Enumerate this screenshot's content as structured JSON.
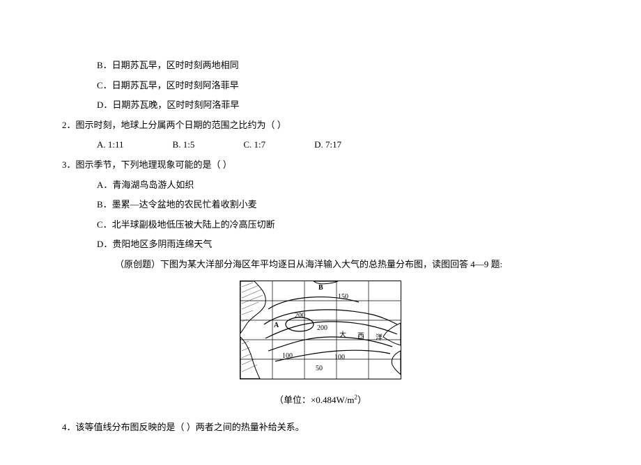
{
  "q1partial": {
    "optB": "B．日期苏瓦早，区时时刻两地相同",
    "optC": "C．日期苏瓦早，区时时刻阿洛菲早",
    "optD": "D．日期苏瓦晚，区时时刻阿洛菲早"
  },
  "q2": {
    "stem": "2．图示时刻，地球上分属两个日期的范围之比约为（    ）",
    "optA": "A. 1:11",
    "optB": "B. 1:5",
    "optC": "C. 1:7",
    "optD": "D. 7:17"
  },
  "q3": {
    "stem": "3．图示季节，下列地理现象可能的是（   ）",
    "optA": "A．青海湖鸟岛游人如织",
    "optB": "B．墨累—达令盆地的农民忙着收割小麦",
    "optC": "C．北半球副极地低压被大陆上的冷高压切断",
    "optD": "D．贵阳地区多阴雨连绵天气"
  },
  "intro": "（原创题）下图为某大洋部分海区年平均逐日从海洋输入大气的总热量分布图，读图回答 4—9 题:",
  "caption": "（单位：×0.484W/m",
  "caption_sup": "2",
  "caption_close": "）",
  "map": {
    "v150": "150",
    "v200a": "200",
    "v200b": "200",
    "v100a": "100",
    "v100b": "100",
    "v50": "50",
    "A": "A",
    "B": "B",
    "c1": "大",
    "c2": "西",
    "c3": "洋"
  },
  "q4": {
    "stem": "4．该等值线分布图反映的是（   ）两者之间的热量补给关系。"
  }
}
